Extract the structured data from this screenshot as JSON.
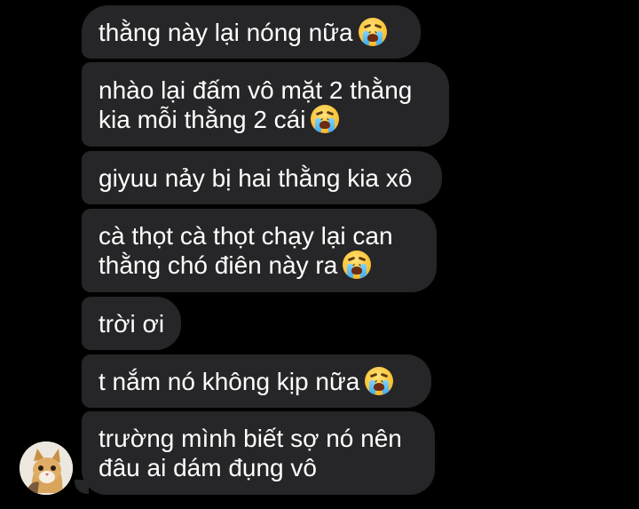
{
  "messages": [
    {
      "lines": [
        "thằng này lại nóng nữa"
      ],
      "emoji_after": "loudly-crying-face"
    },
    {
      "lines": [
        "nhào lại đấm vô mặt 2 thằng",
        "kia mỗi thằng 2 cái"
      ],
      "emoji_after": "loudly-crying-face"
    },
    {
      "lines": [
        "giyuu nảy bị hai thằng kia xô"
      ],
      "emoji_after": null
    },
    {
      "lines": [
        "cà thọt cà thọt chạy lại can",
        "thằng chó điên này ra"
      ],
      "emoji_after": "loudly-crying-face"
    },
    {
      "lines": [
        "trời ơi"
      ],
      "emoji_after": null
    },
    {
      "lines": [
        "t nắm nó không kịp nữa"
      ],
      "emoji_after": "loudly-crying-face"
    },
    {
      "lines": [
        "trường mình biết sợ nó nên",
        "đâu ai dám đụng vô"
      ],
      "emoji_after": null
    }
  ],
  "sender_avatar": {
    "icon": "cat-avatar"
  },
  "colors": {
    "background": "#000000",
    "bubble": "#262628",
    "text": "#ffffff"
  }
}
